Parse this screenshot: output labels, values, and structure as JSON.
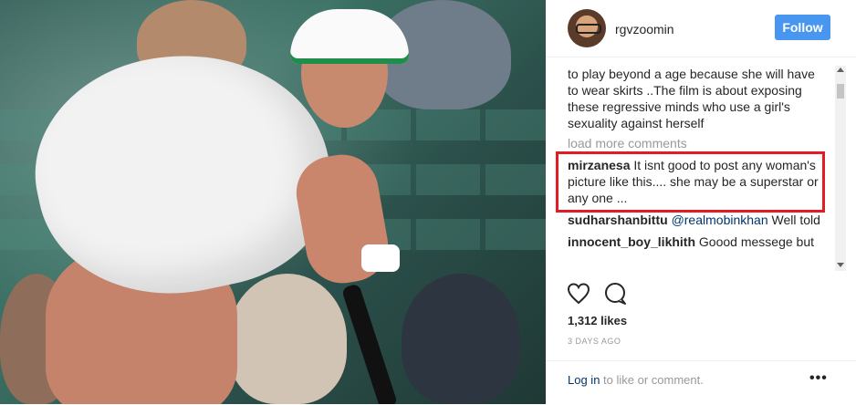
{
  "post": {
    "username": "rgvzoomin",
    "follow_label": "Follow",
    "caption_tail": "to play beyond a age because she will have to wear skirts ..The film is about exposing these regressive minds who use a girl's sexuality against herself",
    "load_more": "load more comments",
    "comments": [
      {
        "user": "mirzanesa",
        "text": "It isnt good to post any woman's picture like this.... she may be a superstar or any one ..."
      },
      {
        "user": "sudharshanbittu",
        "mention": "@realmobinkhan",
        "text": "Well told"
      },
      {
        "user": "innocent_boy_likhith",
        "text": "Goood messege but"
      }
    ],
    "likes": "1,312 likes",
    "date": "3 DAYS AGO",
    "login_link": "Log in",
    "login_rest": "to like or comment.",
    "more_label": "•••"
  },
  "colors": {
    "follow_bg": "#4896f0",
    "highlight": "#e21b24",
    "mention": "#003569",
    "muted": "#999999"
  },
  "icons": [
    "heart-icon",
    "comment-icon",
    "more-options-icon"
  ]
}
